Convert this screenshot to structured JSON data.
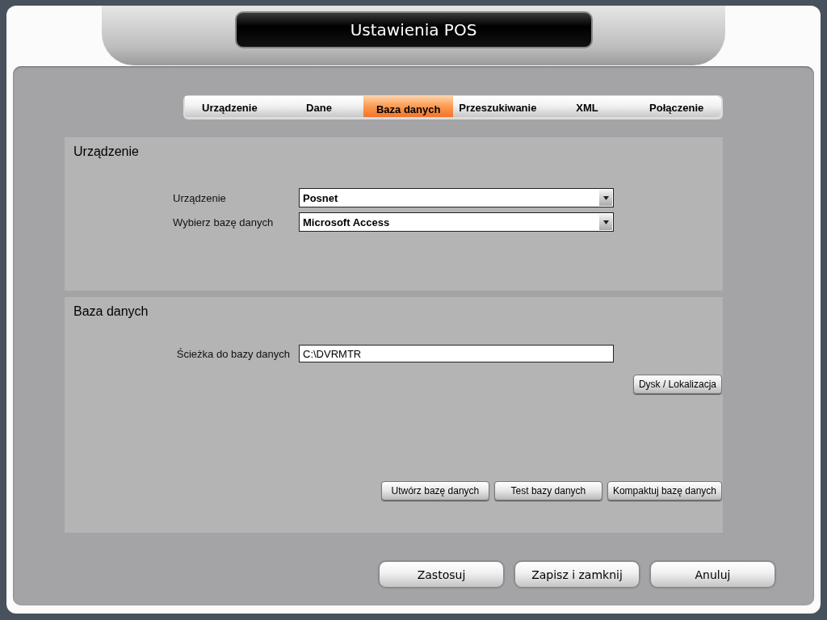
{
  "window": {
    "title": "Ustawienia POS"
  },
  "tabs": [
    {
      "label": "Urządzenie",
      "selected": false
    },
    {
      "label": "Dane",
      "selected": false
    },
    {
      "label": "Baza danych",
      "selected": true
    },
    {
      "label": "Przeszukiwanie",
      "selected": false
    },
    {
      "label": "XML",
      "selected": false
    },
    {
      "label": "Połączenie",
      "selected": false
    }
  ],
  "sections": [
    {
      "title": "Urządzenie",
      "fields": [
        {
          "kind": "dropdown",
          "label": "Urządzenie",
          "value": "Posnet"
        },
        {
          "kind": "dropdown",
          "label": "Wybierz bazę danych",
          "value": "Microsoft Access"
        }
      ]
    },
    {
      "title": "Baza danych",
      "fields": [
        {
          "kind": "text",
          "label": "Ścieżka do bazy danych",
          "value": "C:\\DVRMTR"
        }
      ],
      "field_button": "Dysk / Lokalizacja",
      "buttons": [
        "Utwórz bazę danych",
        "Test bazy danych",
        "Kompaktuj bazę danych"
      ]
    }
  ],
  "footer_buttons": [
    "Zastosuj",
    "Zapisz i zamknij",
    "Anuluj"
  ]
}
